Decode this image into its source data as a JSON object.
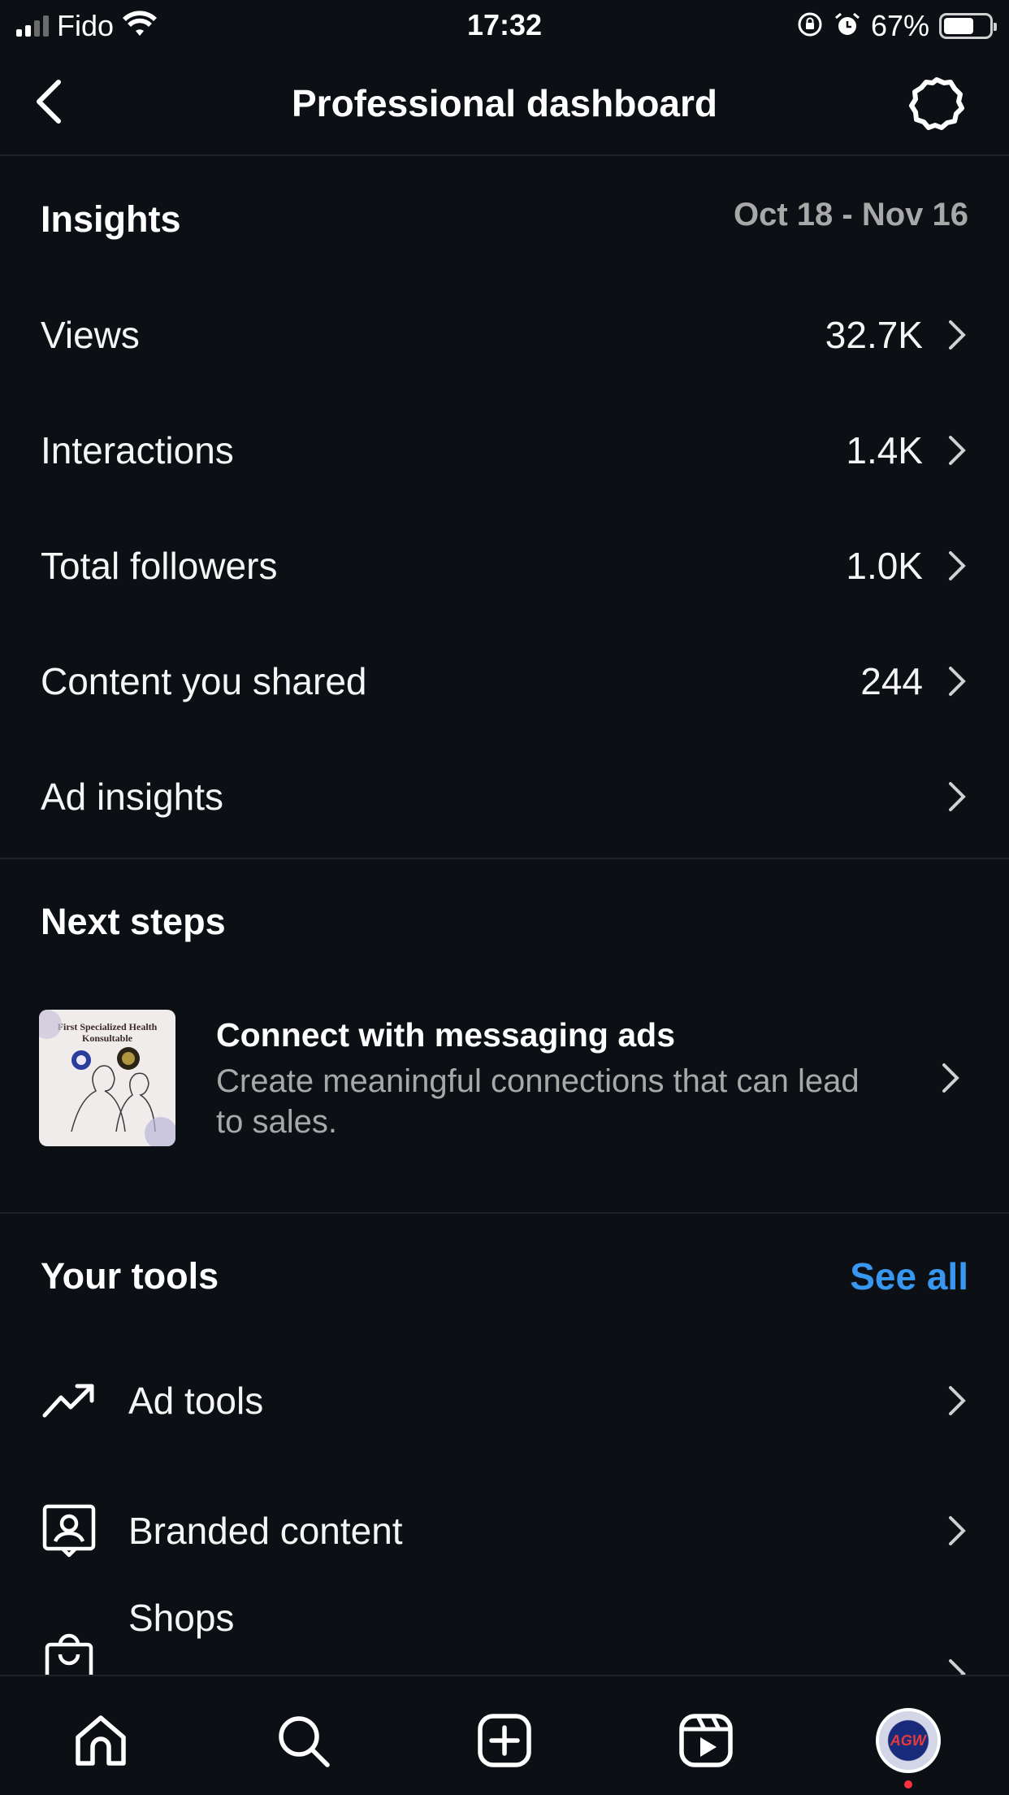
{
  "status_bar": {
    "carrier": "Fido",
    "time": "17:32",
    "battery": "67%",
    "battery_level": 0.67
  },
  "header": {
    "title": "Professional dashboard",
    "back_icon": "chevron-left-icon",
    "settings_icon": "settings-gear-icon"
  },
  "insights": {
    "title": "Insights",
    "date_range": "Oct 18 - Nov 16",
    "rows": [
      {
        "label": "Views",
        "value": "32.7K"
      },
      {
        "label": "Interactions",
        "value": "1.4K"
      },
      {
        "label": "Total followers",
        "value": "1.0K"
      },
      {
        "label": "Content you shared",
        "value": "244"
      },
      {
        "label": "Ad insights",
        "value": ""
      }
    ]
  },
  "next_steps": {
    "title": "Next steps",
    "card": {
      "title": "Connect with messaging ads",
      "description": "Create meaningful connections that can lead to sales.",
      "thumbnail_text": "First Specialized Health Konsultable"
    }
  },
  "tools": {
    "title": "Your tools",
    "see_all": "See all",
    "accent_color": "#3897f0",
    "items": [
      {
        "label": "Ad tools",
        "icon": "trending-up-icon"
      },
      {
        "label": "Branded content",
        "icon": "branded-content-icon"
      },
      {
        "label": "Shops",
        "icon": "shopping-bag-icon"
      }
    ]
  },
  "tab_bar": {
    "items": [
      "home-icon",
      "search-icon",
      "create-icon",
      "reels-icon",
      "profile-avatar"
    ],
    "avatar_text": "AGW"
  }
}
